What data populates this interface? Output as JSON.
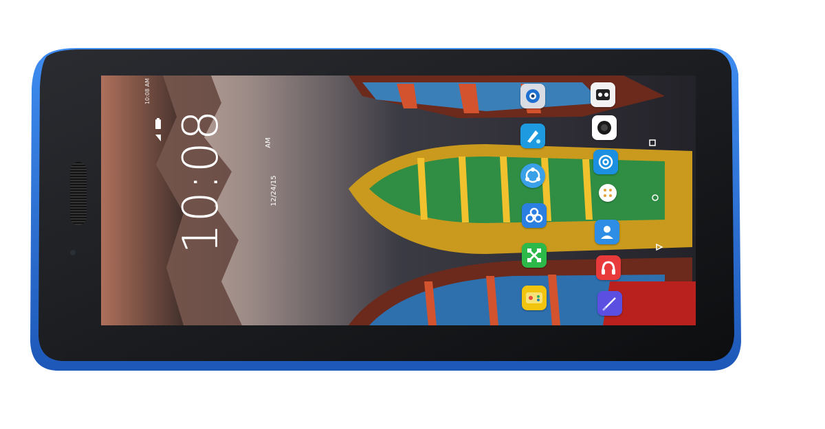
{
  "device": {
    "frame_color": "#1a1b1f",
    "accent_color": "#2f6fd6"
  },
  "status_bar": {
    "time": "10:08 AM"
  },
  "lock_clock": {
    "time": "10:08",
    "ampm": "AM",
    "date": "12/24/15"
  },
  "apps": [
    {
      "label": "",
      "icon": "camera-lens-icon",
      "color": "#d9dde3"
    },
    {
      "label": "",
      "icon": "camera-app-icon",
      "color": "#f2f2f2"
    },
    {
      "label": "",
      "icon": "paint-icon",
      "color": "#1e9ae0"
    },
    {
      "label": "",
      "icon": "photo-icon",
      "color": "#ffffff"
    },
    {
      "label": "",
      "icon": "sync-icon",
      "color": "#3aa0e8"
    },
    {
      "label": "",
      "icon": "at-email-icon",
      "color": "#1c8fe0"
    },
    {
      "label": "",
      "icon": "app-drawer-icon",
      "color": "#ffffff"
    },
    {
      "label": "",
      "icon": "cloud-share-icon",
      "color": "#2b7fe0"
    },
    {
      "label": "",
      "icon": "contacts-icon",
      "color": "#2e8ee6"
    },
    {
      "label": "",
      "icon": "shareit-icon",
      "color": "#2db84a"
    },
    {
      "label": "",
      "icon": "music-icon",
      "color": "#e83a3a"
    },
    {
      "label": "",
      "icon": "game-center-icon",
      "color": "#f1c40f"
    },
    {
      "label": "",
      "icon": "notes-icon",
      "color": "#5a4fe0"
    }
  ],
  "nav": [
    "back-icon",
    "home-icon",
    "recents-icon"
  ]
}
